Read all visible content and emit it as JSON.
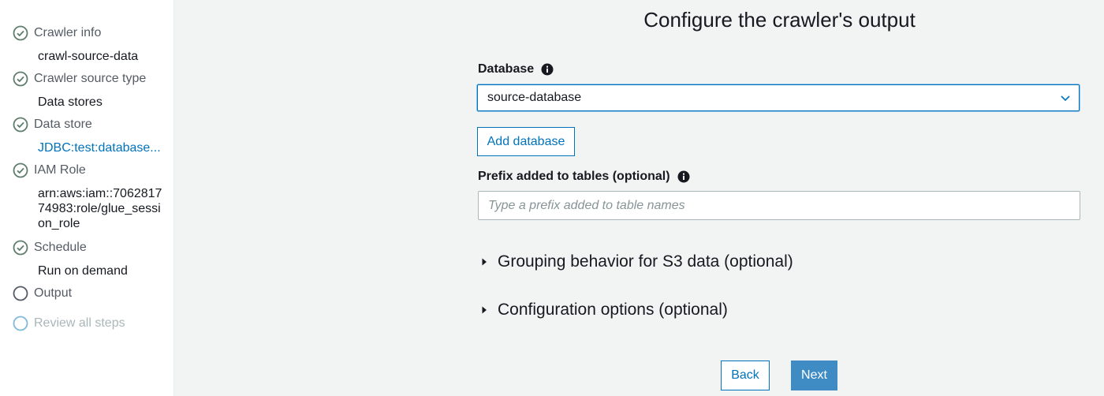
{
  "sidebar": {
    "steps": [
      {
        "title": "Crawler info",
        "detail": "crawl-source-data",
        "state": "complete"
      },
      {
        "title": "Crawler source type",
        "detail": "Data stores",
        "state": "complete"
      },
      {
        "title": "Data store",
        "detail": "JDBC:test:database...",
        "state": "complete"
      },
      {
        "title": "IAM Role",
        "detail": "arn:aws:iam::706281774983:role/glue_session_role",
        "state": "complete"
      },
      {
        "title": "Schedule",
        "detail": "Run on demand",
        "state": "complete"
      },
      {
        "title": "Output",
        "state": "current"
      },
      {
        "title": "Review all steps",
        "state": "disabled"
      }
    ]
  },
  "main": {
    "title": "Configure the crawler's output",
    "database": {
      "label": "Database",
      "selected": "source-database",
      "add_button": "Add database"
    },
    "prefix": {
      "label": "Prefix added to tables (optional)",
      "placeholder": "Type a prefix added to table names",
      "value": ""
    },
    "expanders": [
      {
        "label": "Grouping behavior for S3 data (optional)"
      },
      {
        "label": "Configuration options (optional)"
      }
    ],
    "buttons": {
      "back": "Back",
      "next": "Next"
    }
  },
  "colors": {
    "accent": "#0073bb",
    "primary_button": "#3f8cc5",
    "step_icon": "#5f7d6e",
    "disabled": "#aab7b8"
  }
}
